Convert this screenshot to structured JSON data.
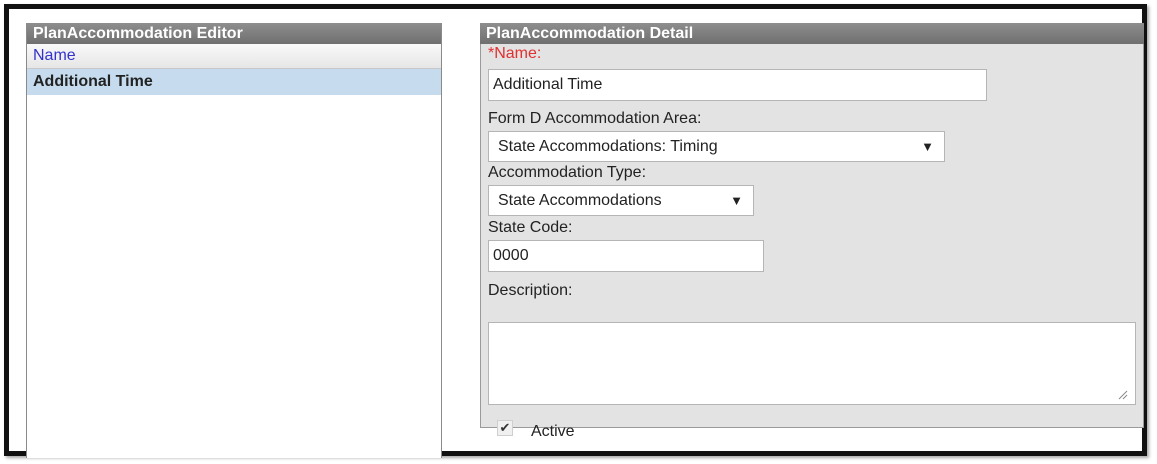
{
  "editor": {
    "title": "PlanAccommodation Editor",
    "column_header": "Name",
    "rows": [
      {
        "name": "Additional Time",
        "selected": true
      }
    ]
  },
  "detail": {
    "title": "PlanAccommodation Detail",
    "name_label": "*Name:",
    "name_value": "Additional Time",
    "area_label": "Form D Accommodation Area:",
    "area_value": "State Accommodations: Timing",
    "type_label": "Accommodation Type:",
    "type_value": "State Accommodations",
    "state_code_label": "State Code:",
    "state_code_value": "0000",
    "description_label": "Description:",
    "description_value": "",
    "active_label": "Active",
    "active_checked": true
  },
  "colors": {
    "header_bg": "#7f7f7f",
    "selected_row": "#c6dcee",
    "required_label": "#e03030",
    "column_header_text": "#3333cc",
    "detail_bg": "#e3e3e3"
  },
  "icons": {
    "dropdown": "triangle-down",
    "checkbox": "check-mark",
    "resize": "resize-grip"
  }
}
